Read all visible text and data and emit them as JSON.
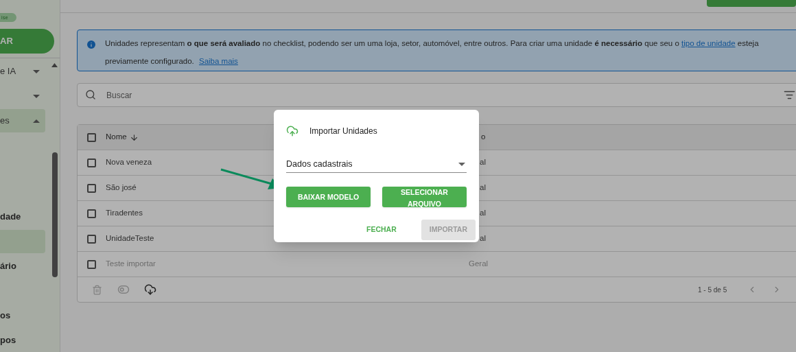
{
  "sidebar": {
    "badge": "ise",
    "primary_button": "AR",
    "items": [
      {
        "label": "e IA",
        "kind": "group",
        "expanded": false,
        "selected": false
      },
      {
        "kind": "group",
        "expanded": false,
        "selected": false
      },
      {
        "label": "es",
        "kind": "group",
        "expanded": true,
        "selected": true,
        "children": [
          {
            "label": "dade",
            "kind": "link",
            "selected": false
          },
          {
            "kind": "link",
            "selected": true
          },
          {
            "label": "ário",
            "kind": "link",
            "selected": false
          }
        ]
      },
      {
        "label": "os",
        "kind": "link",
        "selected": false
      },
      {
        "label": "pos",
        "kind": "link",
        "selected": false
      }
    ]
  },
  "info_alert": {
    "text": "Unidades representam **o que será avaliado** no checklist, podendo ser um uma loja, setor, automóvel, entre outros. Para criar uma unidade **é necessário** que seu o",
    "link": "tipo de unidade",
    "text_after": "esteja previamente configurado.",
    "more_link": "Saiba mais"
  },
  "search": {
    "placeholder": "Buscar"
  },
  "table": {
    "all_checked": false,
    "columns": [
      {
        "label": "Nome",
        "sorted": true
      },
      {
        "label": "o",
        "covered": true
      }
    ],
    "rows": [
      {
        "cells": [
          "Nova veneza",
          "al"
        ],
        "covered": true,
        "checked": false,
        "disabled": false
      },
      {
        "cells": [
          "São josé",
          "al"
        ],
        "covered": true,
        "checked": false,
        "disabled": false
      },
      {
        "cells": [
          "Tiradentes",
          "al"
        ],
        "covered": true,
        "checked": false,
        "disabled": false
      },
      {
        "cells": [
          "UnidadeTeste",
          "al"
        ],
        "covered": true,
        "checked": false,
        "disabled": false
      },
      {
        "cells": [
          "Teste importar",
          "Geral"
        ],
        "covered": false,
        "checked": false,
        "disabled": true
      }
    ],
    "footer": {
      "delete_disabled": true,
      "toggle_disabled": true,
      "pagination": "1 - 5 de 5"
    }
  },
  "dialog": {
    "title": "Importar Unidades",
    "select_value": "Dados cadastrais",
    "buttons": [
      {
        "label": "BAIXAR MODELO",
        "kind": "contained",
        "disabled": false
      },
      {
        "label": "SELECIONAR ARQUIVO",
        "kind": "contained",
        "disabled": false
      },
      {
        "label": "FECHAR",
        "kind": "text",
        "disabled": false
      },
      {
        "label": "IMPORTAR",
        "kind": "contained",
        "disabled": true
      }
    ]
  }
}
